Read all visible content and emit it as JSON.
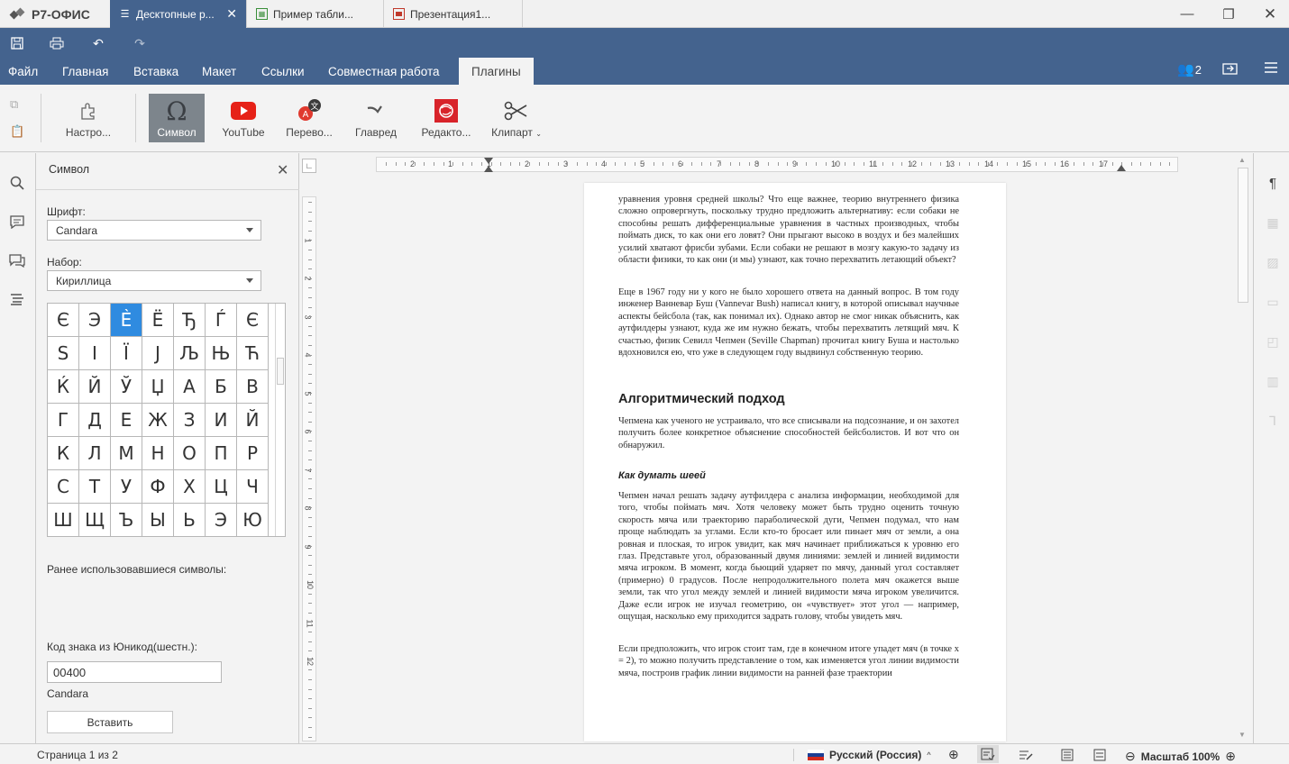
{
  "app": {
    "name": "Р7-ОФИС"
  },
  "tabs": [
    {
      "label": "Десктопные р...",
      "icon": "document-icon",
      "color": "#ffffff"
    },
    {
      "label": "Пример табли...",
      "icon": "spreadsheet-icon",
      "color": "#3a8f3a"
    },
    {
      "label": "Презентация1...",
      "icon": "presentation-icon",
      "color": "#c0392b"
    }
  ],
  "menu": [
    "Файл",
    "Главная",
    "Вставка",
    "Макет",
    "Ссылки",
    "Совместная работа",
    "Плагины"
  ],
  "collab_count": "2",
  "toolbar": {
    "settings": "Настро...",
    "symbol": "Символ",
    "youtube": "YouTube",
    "translate": "Перево...",
    "glavred": "Главред",
    "editor": "Редакто...",
    "clipart": "Клипарт"
  },
  "panel": {
    "title": "Символ",
    "font_label": "Шрифт:",
    "font_value": "Candara",
    "set_label": "Набор:",
    "set_value": "Кириллица",
    "symbols": [
      "Є",
      "Э",
      "Ѐ",
      "Ё",
      "Ђ",
      "Ѓ",
      "Є",
      "Ѕ",
      "І",
      "Ї",
      "Ј",
      "Љ",
      "Њ",
      "Ћ",
      "Ќ",
      "Й",
      "Ў",
      "Џ",
      "А",
      "Б",
      "В",
      "Г",
      "Д",
      "Е",
      "Ж",
      "З",
      "И",
      "Й",
      "К",
      "Л",
      "М",
      "Н",
      "О",
      "П",
      "Р",
      "С",
      "Т",
      "У",
      "Ф",
      "Х",
      "Ц",
      "Ч",
      "Ш",
      "Щ",
      "Ъ",
      "Ы",
      "Ь",
      "Э",
      "Ю"
    ],
    "recent_label": "Ранее использовавшиеся символы:",
    "code_label": "Код знака из Юникод(шестн.):",
    "code_value": "00400",
    "code_font": "Candara",
    "insert_button": "Вставить"
  },
  "ruler_numbers": [
    "2",
    "1",
    "1",
    "2",
    "3",
    "4",
    "5",
    "6",
    "7",
    "8",
    "9",
    "10",
    "11",
    "12",
    "13",
    "14",
    "15",
    "16",
    "17"
  ],
  "document": {
    "p1": "уравнения уровня средней школы? Что еще важнее, теорию внутреннего физика сложно опровергнуть, поскольку трудно предложить альтернативу: если собаки не способны решать дифференциальные уравнения в частных производных, чтобы поймать диск, то как они его ловят? Они прыгают высоко в воздух и без малейших усилий хватают фрисби зубами. Если собаки не решают в мозгу какую-то задачу из области физики, то как они (и мы) узнают, как точно перехватить летающий объект?",
    "p2": "Еще в 1967 году ни у кого не было хорошего ответа на данный вопрос. В том году инженер Ванневар Буш (Vannevar Bush) написал книгу, в которой описывал научные аспекты бейсбола (так, как понимал их). Однако автор не смог никак объяснить, как аутфилдеры узнают, куда же им нужно бежать, чтобы перехватить летящий мяч. К счастью, физик Севилл Чепмен (Seville Chapman) прочитал книгу Буша и настолько вдохновился ею, что уже в следующем году выдвинул собственную теорию.",
    "h1": "Алгоритмический подход",
    "p3": "Чепмена как ученого не устраивало, что все списывали на подсознание, и он захотел получить более конкретное объяснение способностей бейсболистов. И вот что он обнаружил.",
    "h2": "Как думать шеей",
    "p4": "Чепмен начал решать задачу аутфилдера с анализа информации, необходимой для того, чтобы поймать мяч. Хотя человеку может быть трудно оценить точную скорость мяча или траекторию параболической дуги, Чепмен подумал, что нам проще наблюдать за углами. Если кто-то бросает или пинает мяч от земли, а она ровная и плоская, то игрок увидит, как мяч начинает приближаться к уровню его глаз. Представьте угол, образованный двумя линиями: землей и линией видимости мяча игроком. В момент, когда бьющий ударяет по мячу, данный угол составляет (примерно) 0 градусов. После непродолжительного полета мяч окажется выше земли, так что угол между землей и линией видимости мяча игроком увеличится. Даже если игрок не изучал геометрию, он «чувствует» этот угол — например, ощущая, насколько ему приходится задрать голову, чтобы увидеть мяч.",
    "p5": "Если предположить, что игрок стоит там, где в конечном итоге упадет мяч (в точке x = 2), то можно получить представление о том, как изменяется угол линии видимости мяча, построив график линии видимости на ранней фазе траектории"
  },
  "status": {
    "page": "Страница 1 из 2",
    "language": "Русский (Россия)",
    "zoom": "Масштаб 100%"
  },
  "colors": {
    "header": "#44638e",
    "selected_cell": "#2f8be0",
    "youtube": "#e62117",
    "editor": "#d8232a"
  }
}
